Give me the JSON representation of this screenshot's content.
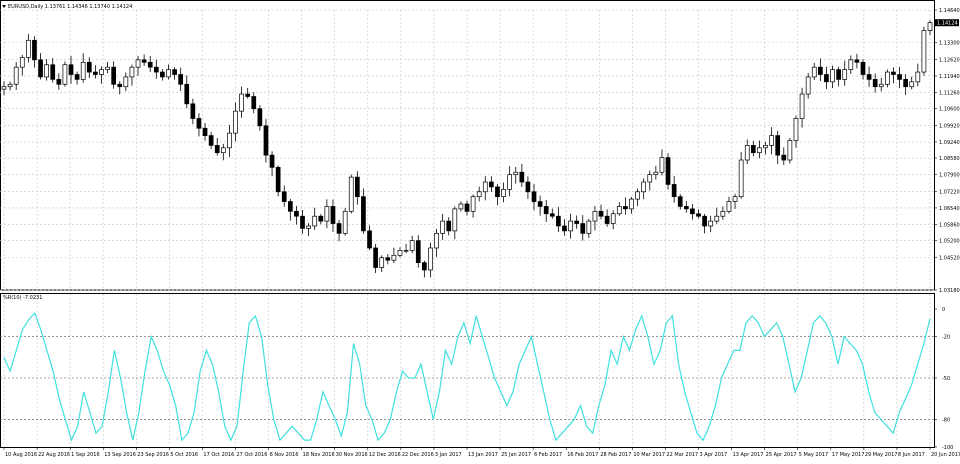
{
  "window": {
    "title": "EURUSD,Daily  1.13761 1.14346 1.13740 1.14124",
    "current_price": "1.14124"
  },
  "colors": {
    "background": "#ffffff",
    "grid": "#c8c8c8",
    "candle": "#000000",
    "wpr_line": "#40e0e0"
  },
  "chart_data": [
    {
      "type": "candlestick",
      "title": "EURUSD,Daily",
      "ohlc_header": "1.13761 1.14346 1.13740 1.14124",
      "y_ticks": [
        "1.14640",
        "1.13300",
        "1.12620",
        "1.11940",
        "1.11260",
        "1.10600",
        "1.09920",
        "1.09240",
        "1.08580",
        "1.07900",
        "1.07220",
        "1.06540",
        "1.05860",
        "1.05200",
        "1.04520",
        "1.03180"
      ],
      "ylim": [
        1.0318,
        1.1464
      ],
      "grid": true,
      "close_path": [
        1.115,
        1.116,
        1.123,
        1.127,
        1.134,
        1.126,
        1.119,
        1.124,
        1.118,
        1.116,
        1.124,
        1.12,
        1.118,
        1.125,
        1.121,
        1.12,
        1.122,
        1.123,
        1.116,
        1.115,
        1.119,
        1.123,
        1.126,
        1.125,
        1.123,
        1.121,
        1.119,
        1.122,
        1.12,
        1.116,
        1.108,
        1.102,
        1.098,
        1.095,
        1.091,
        1.088,
        1.09,
        1.096,
        1.105,
        1.112,
        1.111,
        1.106,
        1.099,
        1.087,
        1.082,
        1.072,
        1.068,
        1.064,
        1.062,
        1.057,
        1.058,
        1.062,
        1.06,
        1.066,
        1.059,
        1.055,
        1.064,
        1.078,
        1.07,
        1.056,
        1.049,
        1.041,
        1.045,
        1.044,
        1.046,
        1.048,
        1.048,
        1.052,
        1.043,
        1.04,
        1.049,
        1.055,
        1.06,
        1.056,
        1.065,
        1.067,
        1.064,
        1.07,
        1.072,
        1.076,
        1.074,
        1.07,
        1.073,
        1.079,
        1.08,
        1.076,
        1.072,
        1.068,
        1.066,
        1.063,
        1.062,
        1.058,
        1.056,
        1.06,
        1.059,
        1.055,
        1.06,
        1.064,
        1.062,
        1.059,
        1.063,
        1.066,
        1.065,
        1.069,
        1.072,
        1.076,
        1.079,
        1.08,
        1.086,
        1.075,
        1.07,
        1.066,
        1.065,
        1.063,
        1.062,
        1.058,
        1.06,
        1.062,
        1.064,
        1.068,
        1.07,
        1.085,
        1.091,
        1.088,
        1.09,
        1.091,
        1.095,
        1.087,
        1.085,
        1.093,
        1.102,
        1.112,
        1.119,
        1.123,
        1.12,
        1.117,
        1.122,
        1.118,
        1.122,
        1.126,
        1.125,
        1.12,
        1.118,
        1.115,
        1.116,
        1.121,
        1.12,
        1.118,
        1.115,
        1.117,
        1.121,
        1.138,
        1.1412
      ]
    },
    {
      "type": "line",
      "title": "%R(10) -7.0231",
      "y_ticks": [
        "0",
        "-20",
        "-50",
        "-80",
        "-100"
      ],
      "ylim": [
        -100,
        0
      ],
      "series": [
        {
          "values": [
            -35,
            -45,
            -30,
            -15,
            -8,
            -3,
            -15,
            -30,
            -45,
            -65,
            -80,
            -95,
            -85,
            -60,
            -75,
            -90,
            -85,
            -60,
            -30,
            -50,
            -75,
            -95,
            -75,
            -45,
            -20,
            -30,
            -45,
            -55,
            -70,
            -95,
            -90,
            -75,
            -45,
            -30,
            -40,
            -60,
            -85,
            -95,
            -85,
            -45,
            -10,
            -5,
            -20,
            -55,
            -80,
            -95,
            -90,
            -85,
            -90,
            -95,
            -95,
            -80,
            -60,
            -70,
            -80,
            -92,
            -75,
            -25,
            -40,
            -70,
            -80,
            -95,
            -90,
            -80,
            -60,
            -45,
            -50,
            -50,
            -40,
            -60,
            -80,
            -60,
            -30,
            -40,
            -20,
            -10,
            -25,
            -5,
            -20,
            -35,
            -50,
            -60,
            -70,
            -60,
            -40,
            -30,
            -20,
            -40,
            -60,
            -80,
            -95,
            -90,
            -85,
            -80,
            -70,
            -85,
            -90,
            -70,
            -55,
            -30,
            -40,
            -20,
            -30,
            -15,
            -5,
            -20,
            -40,
            -30,
            -10,
            -5,
            -40,
            -60,
            -75,
            -90,
            -95,
            -85,
            -70,
            -50,
            -40,
            -30,
            -30,
            -10,
            -5,
            -10,
            -20,
            -15,
            -10,
            -20,
            -40,
            -60,
            -50,
            -30,
            -10,
            -5,
            -10,
            -20,
            -40,
            -20,
            -25,
            -30,
            -40,
            -60,
            -75,
            -80,
            -85,
            -90,
            -75,
            -65,
            -55,
            -40,
            -25,
            -7
          ]
        }
      ]
    }
  ],
  "time_axis": [
    "10 Aug 2016",
    "22 Aug 2016",
    "1 Sep 2016",
    "13 Sep 2016",
    "23 Sep 2016",
    "5 Oct 2016",
    "17 Oct 2016",
    "27 Oct 2016",
    "8 Nov 2016",
    "18 Nov 2016",
    "30 Nov 2016",
    "12 Dec 2016",
    "22 Dec 2016",
    "3 Jan 2017",
    "13 Jan 2017",
    "25 Jan 2017",
    "6 Feb 2017",
    "16 Feb 2017",
    "28 Feb 2017",
    "10 Mar 2017",
    "22 Mar 2017",
    "3 Apr 2017",
    "13 Apr 2017",
    "25 Apr 2017",
    "5 May 2017",
    "17 May 2017",
    "29 May 2017",
    "8 Jun 2017",
    "20 Jun 2017"
  ]
}
